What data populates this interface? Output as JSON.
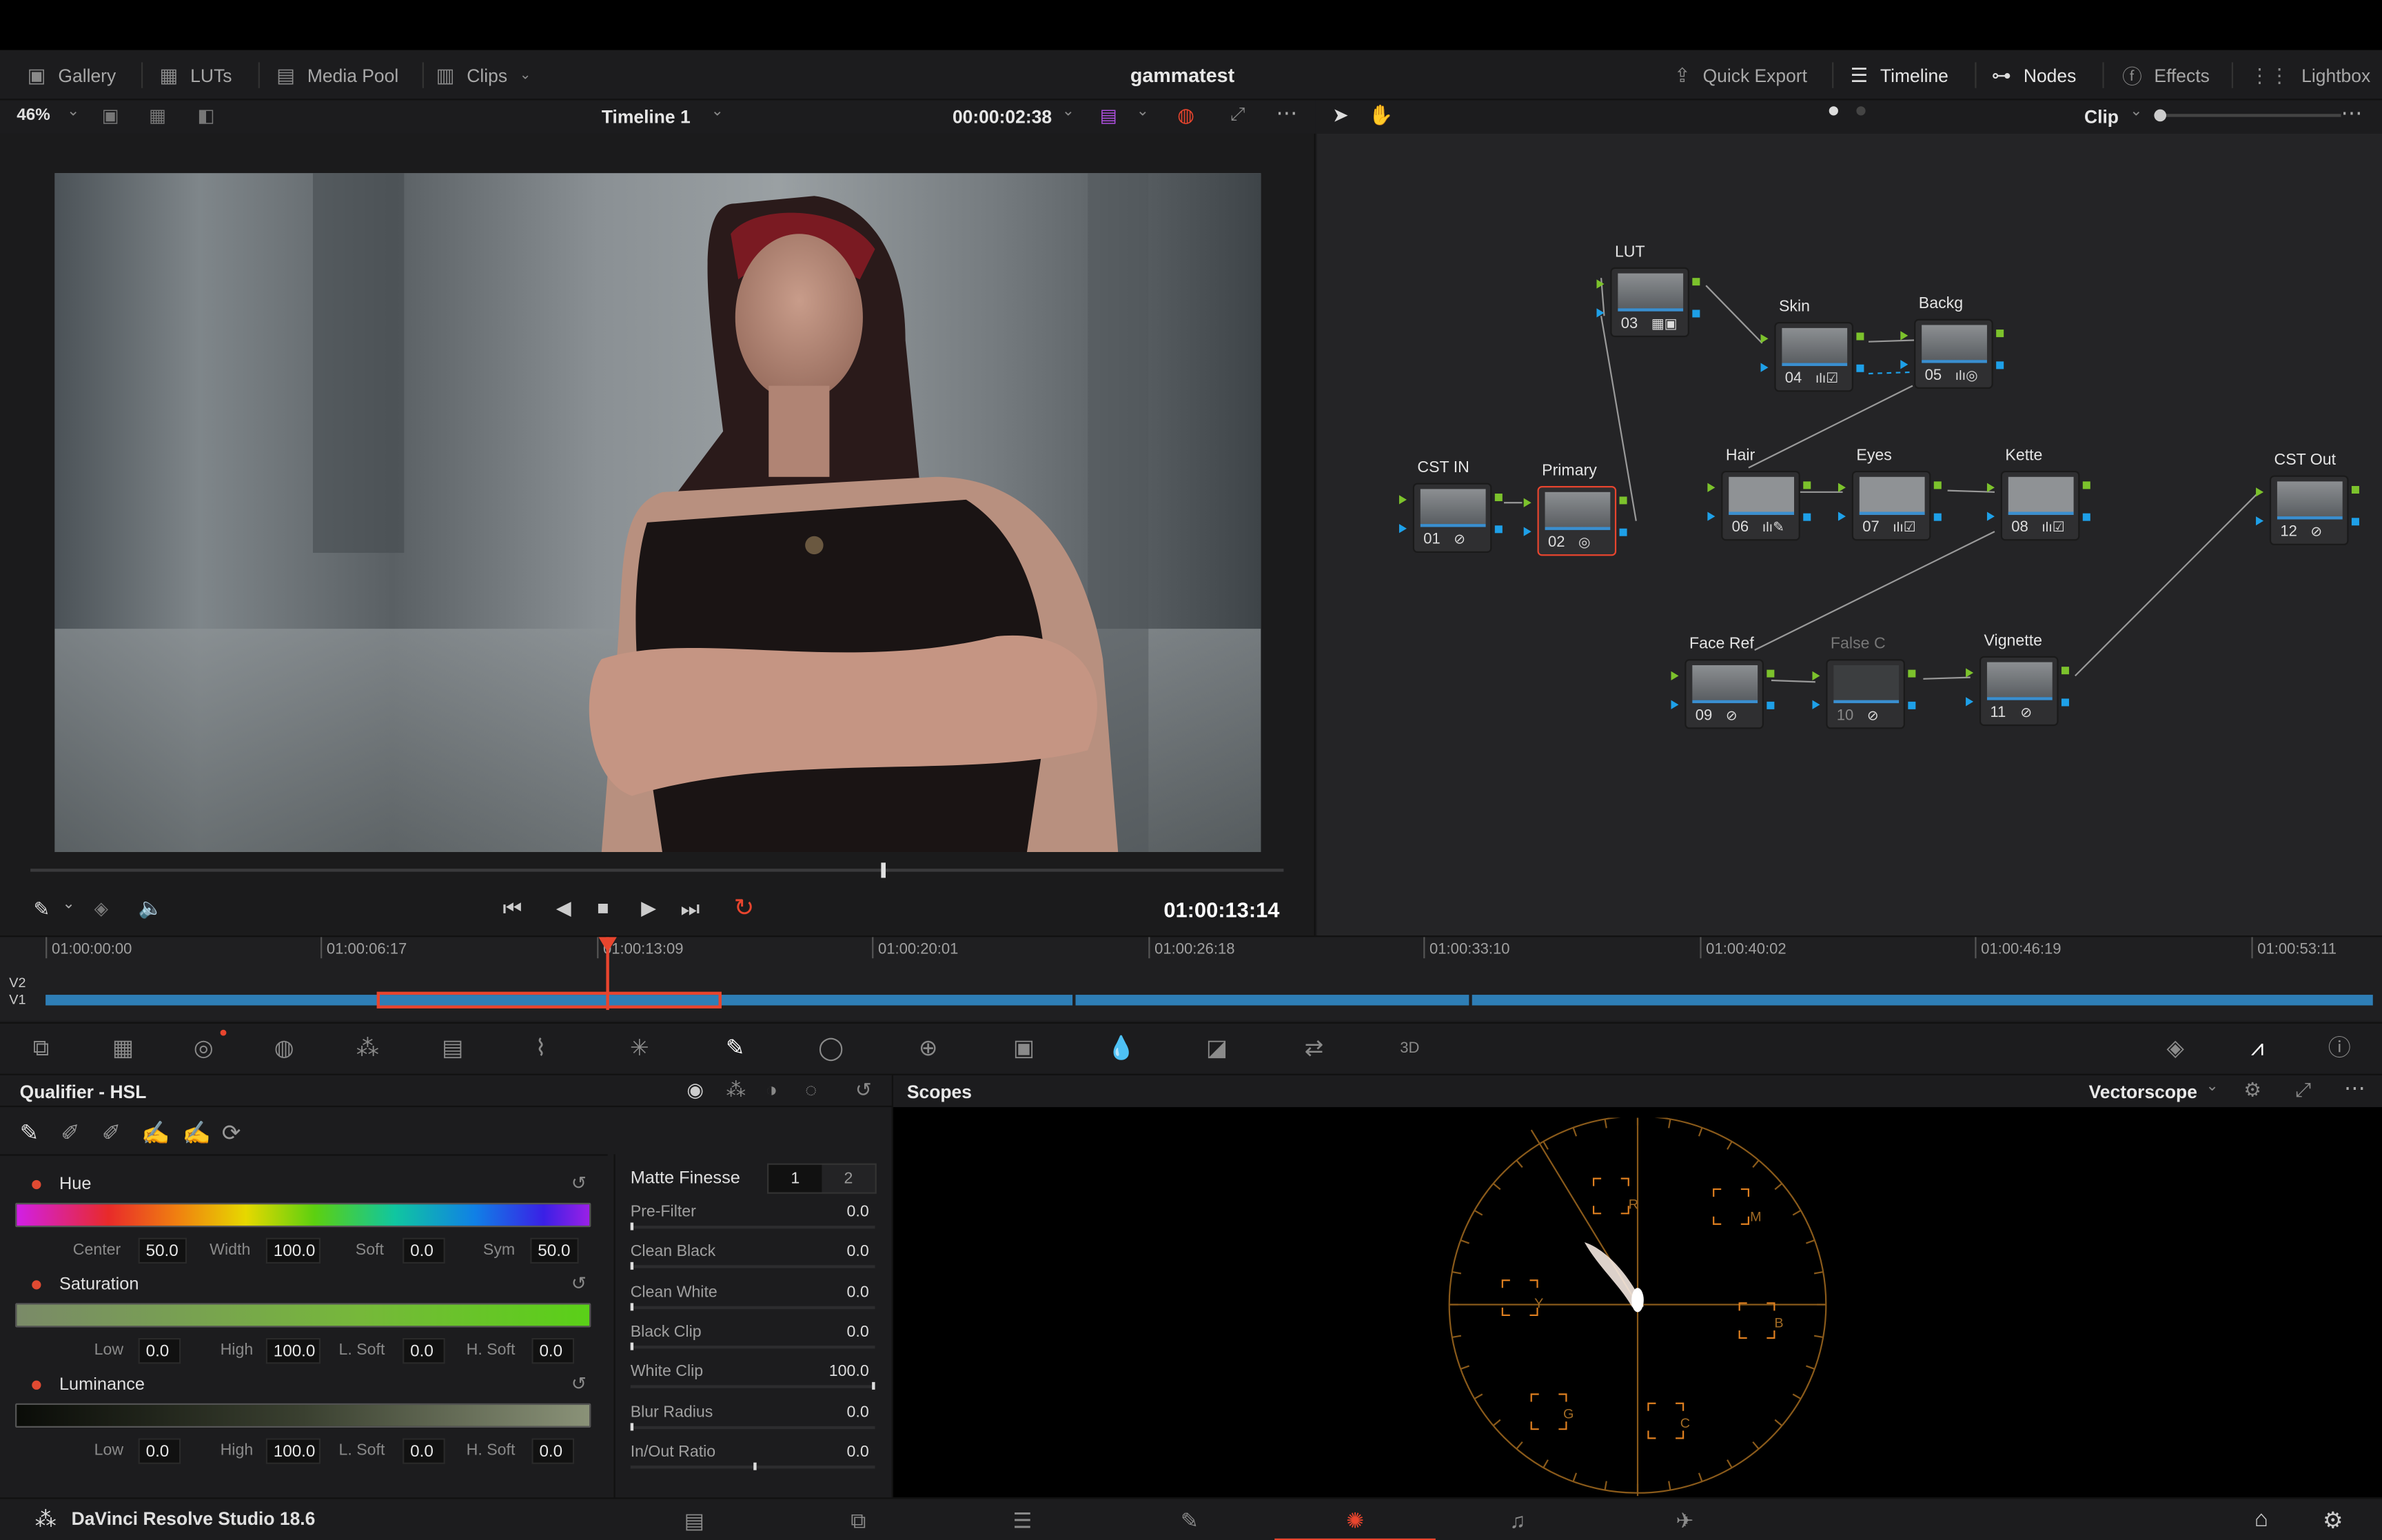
{
  "menubar": {
    "gallery": "Gallery",
    "luts": "LUTs",
    "media_pool": "Media Pool",
    "clips": "Clips",
    "project": "gammatest",
    "quick_export": "Quick Export",
    "timeline": "Timeline",
    "nodes": "Nodes",
    "effects": "Effects",
    "lightbox": "Lightbox"
  },
  "viewer": {
    "zoom": "46%",
    "timeline_name": "Timeline 1",
    "timecode": "00:00:02:38",
    "current_tc": "01:00:13:14",
    "scrub_position": 0.68
  },
  "node_editor": {
    "mode": "Clip",
    "nodes": [
      {
        "id": "03",
        "label": "LUT"
      },
      {
        "id": "04",
        "label": "Skin"
      },
      {
        "id": "05",
        "label": "Backg"
      },
      {
        "id": "01",
        "label": "CST IN"
      },
      {
        "id": "02",
        "label": "Primary"
      },
      {
        "id": "06",
        "label": "Hair"
      },
      {
        "id": "07",
        "label": "Eyes"
      },
      {
        "id": "08",
        "label": "Kette"
      },
      {
        "id": "12",
        "label": "CST Out"
      },
      {
        "id": "09",
        "label": "Face Ref"
      },
      {
        "id": "10",
        "label": "False C"
      },
      {
        "id": "11",
        "label": "Vignette"
      }
    ]
  },
  "timeline": {
    "tracks": [
      "V2",
      "V1"
    ],
    "ticks": [
      "01:00:00:00",
      "01:00:06:17",
      "01:00:13:09",
      "01:00:20:01",
      "01:00:26:18",
      "01:00:33:10",
      "01:00:40:02",
      "01:00:46:19",
      "01:00:53:11"
    ]
  },
  "qualifier": {
    "title": "Qualifier - HSL",
    "hue": {
      "label": "Hue",
      "center_label": "Center",
      "center": "50.0",
      "width_label": "Width",
      "width": "100.0",
      "soft_label": "Soft",
      "soft": "0.0",
      "sym_label": "Sym",
      "sym": "50.0"
    },
    "saturation": {
      "label": "Saturation",
      "low_label": "Low",
      "low": "0.0",
      "high_label": "High",
      "high": "100.0",
      "lsoft_label": "L. Soft",
      "lsoft": "0.0",
      "hsoft_label": "H. Soft",
      "hsoft": "0.0"
    },
    "luminance": {
      "label": "Luminance",
      "low_label": "Low",
      "low": "0.0",
      "high_label": "High",
      "high": "100.0",
      "lsoft_label": "L. Soft",
      "lsoft": "0.0",
      "hsoft_label": "H. Soft",
      "hsoft": "0.0"
    }
  },
  "matte_finesse": {
    "title": "Matte Finesse",
    "tab1": "1",
    "tab2": "2",
    "rows": [
      {
        "name": "Pre-Filter",
        "value": "0.0"
      },
      {
        "name": "Clean Black",
        "value": "0.0"
      },
      {
        "name": "Clean White",
        "value": "0.0"
      },
      {
        "name": "Black Clip",
        "value": "0.0"
      },
      {
        "name": "White Clip",
        "value": "100.0"
      },
      {
        "name": "Blur Radius",
        "value": "0.0"
      },
      {
        "name": "In/Out Ratio",
        "value": "0.0"
      }
    ]
  },
  "scopes": {
    "title": "Scopes",
    "mode": "Vectorscope",
    "targets": [
      "R",
      "M",
      "B",
      "C",
      "G",
      "Y"
    ]
  },
  "status": {
    "app_name": "DaVinci Resolve Studio 18.6"
  },
  "colors": {
    "accent": "#e8452e",
    "node_green": "#7cc22c",
    "node_blue": "#1ea0e8",
    "clip_blue": "#2e7eb6"
  }
}
